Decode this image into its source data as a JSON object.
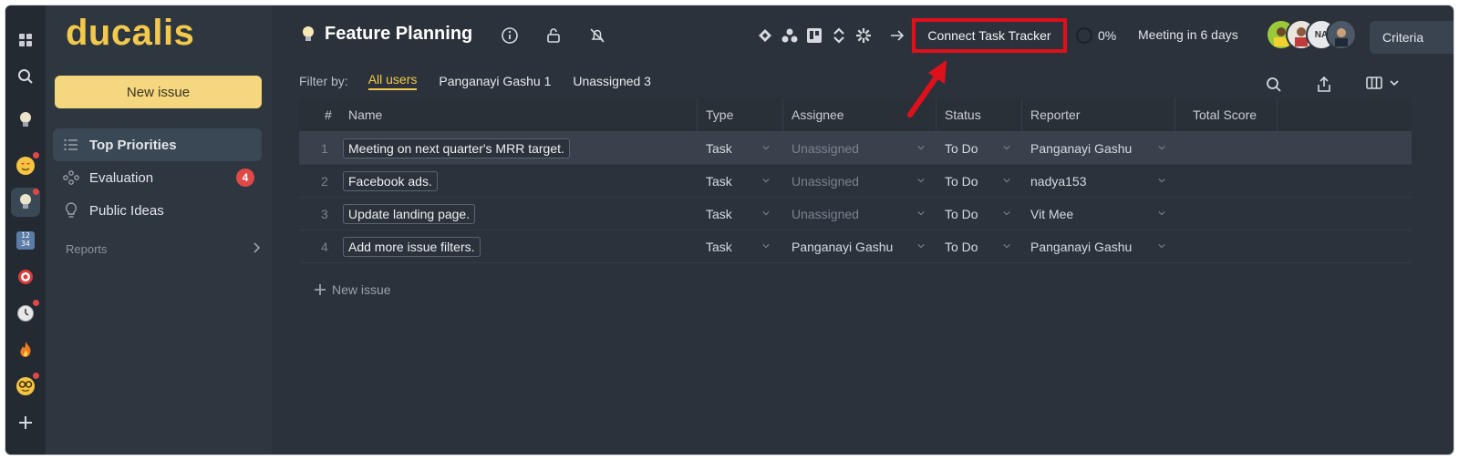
{
  "app": {
    "logo": "ducalis",
    "new_issue_label": "New issue"
  },
  "sidebar": {
    "items": [
      {
        "label": "Top Priorities",
        "icon": "list-icon",
        "active": true
      },
      {
        "label": "Evaluation",
        "icon": "network-icon",
        "badge": "4"
      },
      {
        "label": "Public Ideas",
        "icon": "lightbulb-outline-icon"
      }
    ],
    "reports_label": "Reports"
  },
  "rail": {
    "icons": [
      "grid-icon",
      "search-icon",
      "lightbulb-icon",
      "heart-eyes-face-icon",
      "lightbulb-board-icon",
      "numbers-icon",
      "target-icon",
      "clock-icon",
      "fire-icon",
      "nerd-face-icon",
      "plus-icon"
    ]
  },
  "header": {
    "project_title": "Feature Planning",
    "connect_label": "Connect Task Tracker",
    "progress": "0%",
    "meeting": "Meeting in 6 days",
    "avatar_initials": "NA",
    "criteria_label": "Criteria"
  },
  "filter": {
    "label": "Filter by:",
    "options": [
      "All users",
      "Panganayi Gashu 1",
      "Unassigned 3"
    ],
    "active_index": 0
  },
  "table": {
    "columns": [
      "#",
      "Name",
      "Type",
      "Assignee",
      "Status",
      "Reporter",
      "Total Score"
    ],
    "rows": [
      {
        "num": "1",
        "name": "Meeting on next quarter's MRR target.",
        "type": "Task",
        "assignee": "Unassigned",
        "status": "To Do",
        "reporter": "Panganayi Gashu"
      },
      {
        "num": "2",
        "name": "Facebook ads.",
        "type": "Task",
        "assignee": "Unassigned",
        "status": "To Do",
        "reporter": "nadya153"
      },
      {
        "num": "3",
        "name": "Update landing page.",
        "type": "Task",
        "assignee": "Unassigned",
        "status": "To Do",
        "reporter": "Vit Mee"
      },
      {
        "num": "4",
        "name": "Add more issue filters.",
        "type": "Task",
        "assignee": "Panganayi Gashu",
        "status": "To Do",
        "reporter": "Panganayi Gashu"
      }
    ],
    "new_issue_label": "New issue"
  },
  "colors": {
    "accent": "#f2c94c",
    "highlight_box": "#e0101b",
    "badge": "#e04848"
  }
}
